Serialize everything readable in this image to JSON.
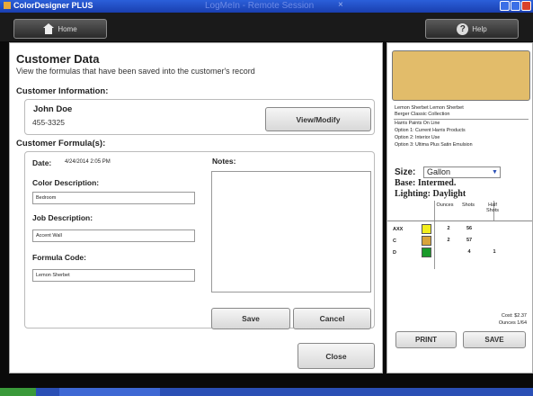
{
  "window": {
    "app_title": "ColorDesigner PLUS",
    "remote_title": "LogMeIn - Remote Session",
    "remote_close": "×"
  },
  "topbar": {
    "home_label": "Home",
    "help_label": "Help"
  },
  "page": {
    "title": "Customer Data",
    "subtitle": "View the formulas that have been saved into the customer's record"
  },
  "customer_info": {
    "heading": "Customer Information:",
    "name": "John Doe",
    "phone": "455-3325",
    "view_modify_label": "View/Modify"
  },
  "formulas": {
    "heading": "Customer Formula(s):",
    "date_label": "Date:",
    "date_value": "4/24/2014 2:05 PM",
    "color_desc_label": "Color Description:",
    "color_desc_value": "Bedroom",
    "job_desc_label": "Job Description:",
    "job_desc_value": "Accent Wall",
    "formula_code_label": "Formula Code:",
    "formula_code_value": "Lemon Sherbet",
    "notes_label": "Notes:",
    "notes_value": "",
    "save_label": "Save",
    "cancel_label": "Cancel"
  },
  "close_label": "Close",
  "side": {
    "swatch_color": "#e2bc6a",
    "color_name": "Lemon Sherbet Lemon Sherbet",
    "collection": "Berger Classic Collection",
    "line": "Harris Paints On Line",
    "option1": "Option 1:  Current Harris Products",
    "option2": "Option 2:  Interior Use",
    "option3": "Option 3:  Ultima Plus Satin Emulsion",
    "size_label": "Size:",
    "size_value": "Gallon",
    "base_text": "Base:  Intermed.",
    "lighting_text": "Lighting:  Daylight",
    "col_ounces": "Ounces",
    "col_shots": "Shots",
    "col_half_shots": "Half Shots",
    "colorants": [
      {
        "code": "AXX",
        "color": "#f3ee1c",
        "ounces": "2",
        "shots": "56",
        "half_shots": ""
      },
      {
        "code": "C",
        "color": "#d9a43a",
        "ounces": "2",
        "shots": "57",
        "half_shots": ""
      },
      {
        "code": "D",
        "color": "#1a9a2a",
        "ounces": "",
        "shots": "4",
        "half_shots": "1"
      }
    ],
    "cost": "Cost: $2.37",
    "ounces_total": "Ounces 1/64",
    "print_label": "PRINT",
    "save_label": "SAVE"
  }
}
